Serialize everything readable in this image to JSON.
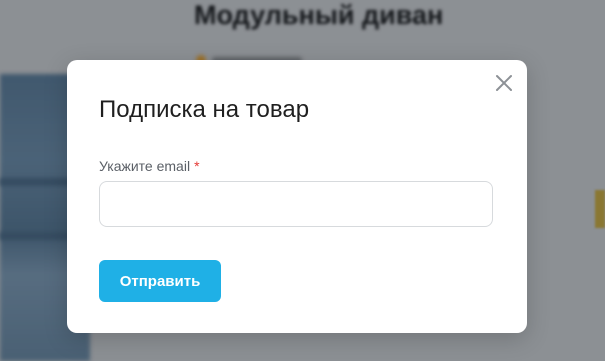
{
  "background": {
    "product_title": "Модульный диван"
  },
  "modal": {
    "title": "Подписка на товар",
    "email_label": "Укажите email",
    "required_mark": "*",
    "email_value": "",
    "email_placeholder": "",
    "submit_label": "Отправить",
    "close_icon": "close-icon"
  },
  "colors": {
    "accent": "#1fb0e6",
    "required": "#e53935",
    "modal_bg": "#ffffff",
    "overlay": "rgba(0,0,0,0.30)"
  }
}
